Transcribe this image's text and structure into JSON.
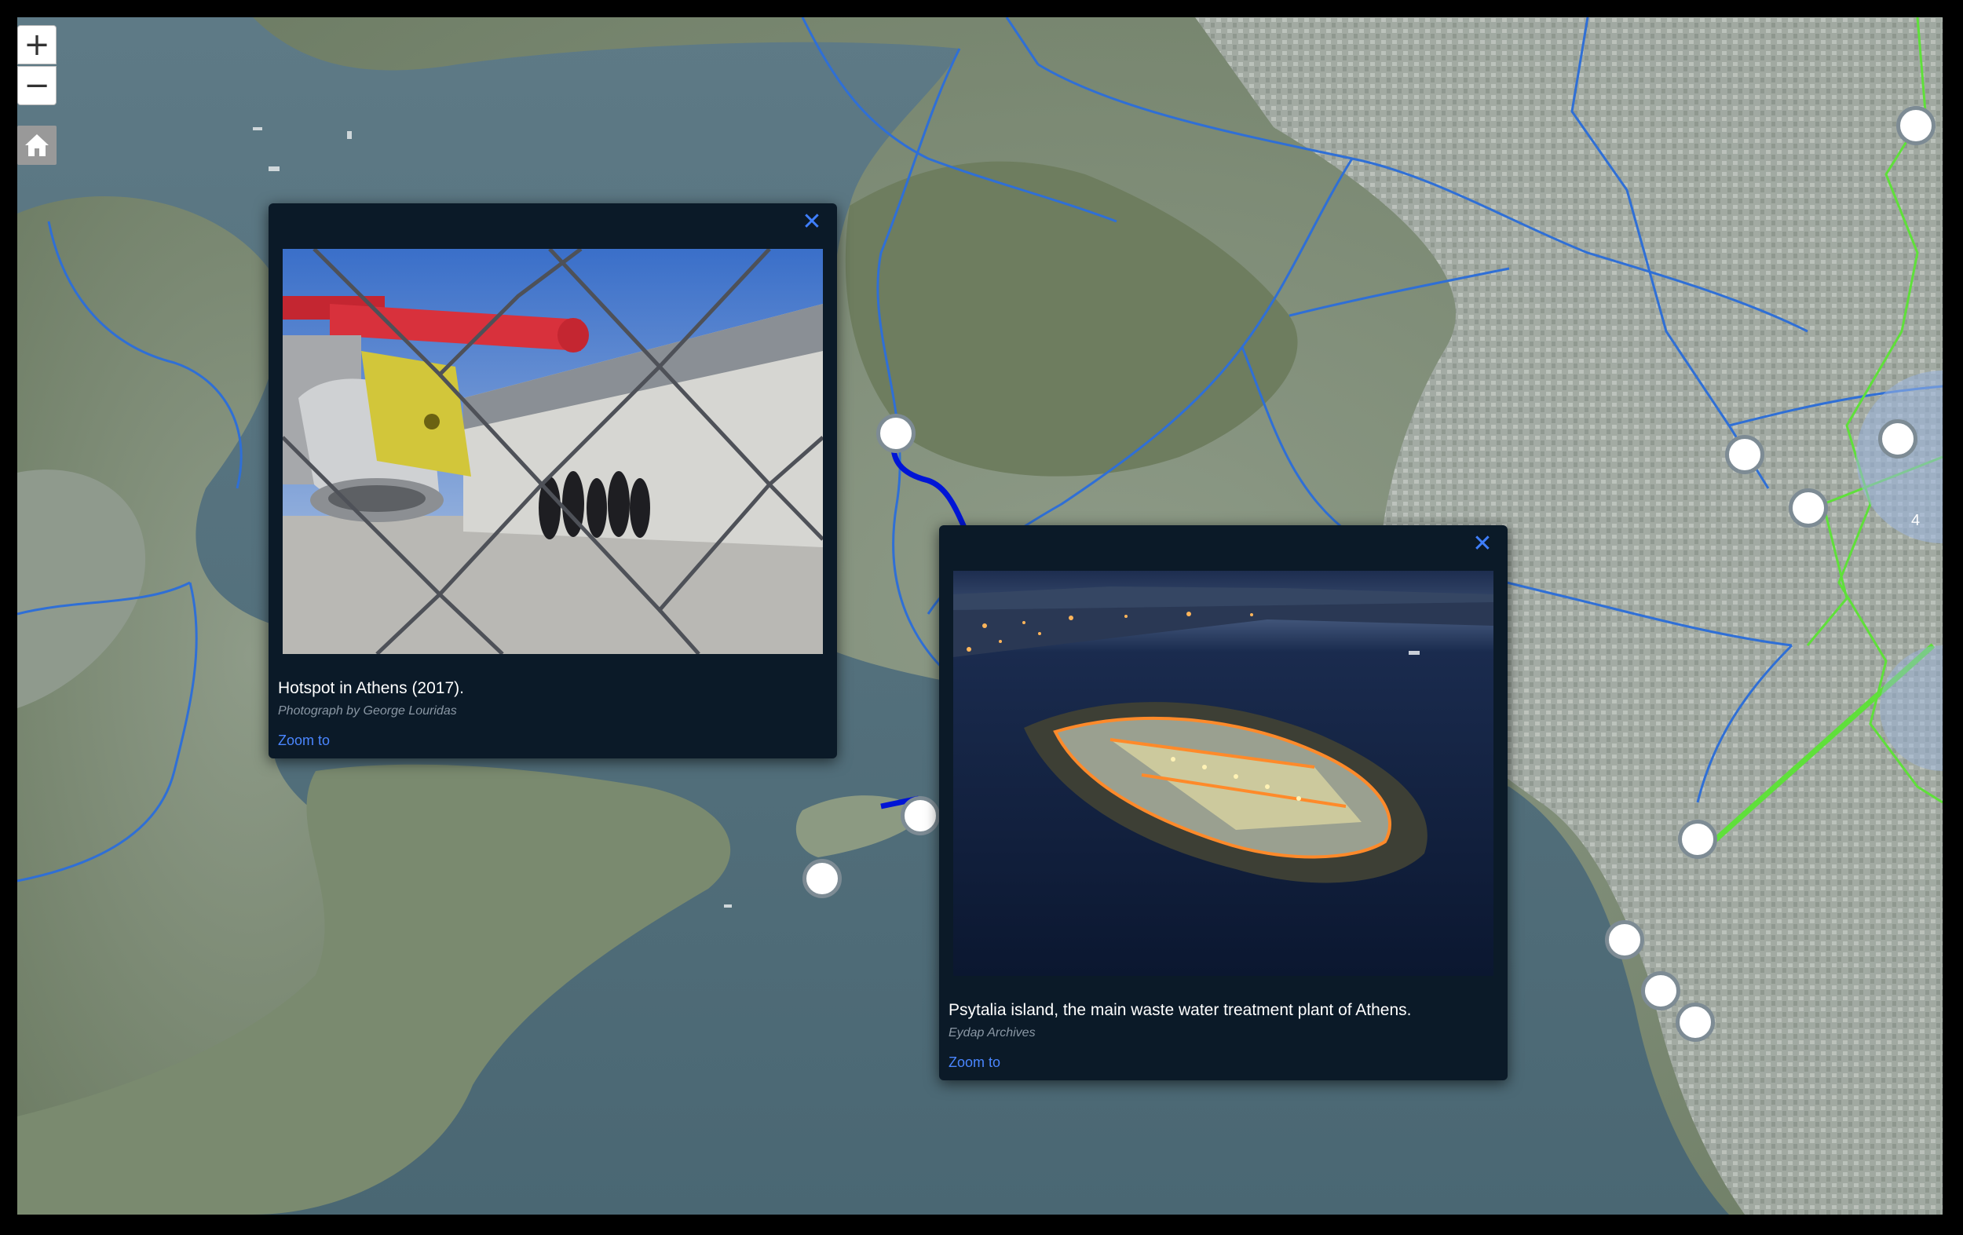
{
  "controls": {
    "zoom_in": "+",
    "zoom_out": "−"
  },
  "icons": {
    "home": "home-icon",
    "close": "close-icon"
  },
  "colors": {
    "popup_bg": "#0b1a28",
    "link": "#4a86ff",
    "route": "#0015d6",
    "network": "#2f6fd6",
    "green_network": "#5fe03a"
  },
  "popup_hotspot": {
    "close": "✕",
    "caption": "Hotspot in Athens (2017).",
    "credit": "Photograph by George Louridas",
    "zoom_link": "Zoom to"
  },
  "popup_psytalia": {
    "close": "✕",
    "caption": "Psytalia island, the main waste water treatment plant of Athens.",
    "credit": "Eydap Archives",
    "zoom_link": "Zoom to"
  },
  "cluster_label": "4"
}
